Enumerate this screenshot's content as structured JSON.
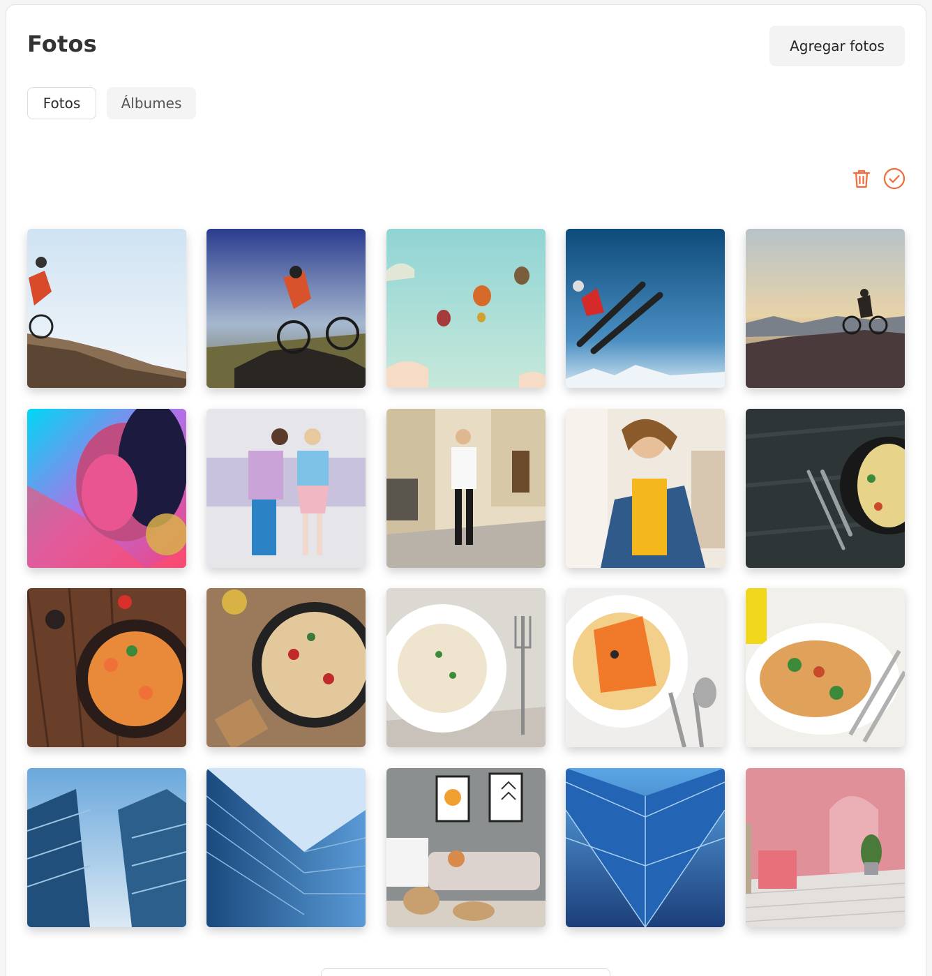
{
  "header": {
    "title": "Fotos",
    "add_button_label": "Agregar fotos"
  },
  "tabs": [
    {
      "label": "Fotos",
      "active": true
    },
    {
      "label": "Álbumes",
      "active": false
    }
  ],
  "actions": {
    "delete_icon": "trash-icon",
    "select_icon": "check-circle-icon",
    "accent_color": "#f26b3a"
  },
  "photos": [
    {
      "subject": "mountain-biker-sky"
    },
    {
      "subject": "mountain-biker-rocks"
    },
    {
      "subject": "hot-air-balloons"
    },
    {
      "subject": "skier-jump"
    },
    {
      "subject": "biker-sunset"
    },
    {
      "subject": "neon-portrait"
    },
    {
      "subject": "fashion-couple"
    },
    {
      "subject": "street-fashion"
    },
    {
      "subject": "woman-denim-jacket"
    },
    {
      "subject": "pasta-dark-table"
    },
    {
      "subject": "shrimp-pasta"
    },
    {
      "subject": "pasta-skillet"
    },
    {
      "subject": "fettuccine-plate"
    },
    {
      "subject": "salmon-spaghetti"
    },
    {
      "subject": "seafood-pasta"
    },
    {
      "subject": "skyscrapers"
    },
    {
      "subject": "glass-building"
    },
    {
      "subject": "living-room"
    },
    {
      "subject": "glass-facade"
    },
    {
      "subject": "pink-room"
    }
  ]
}
